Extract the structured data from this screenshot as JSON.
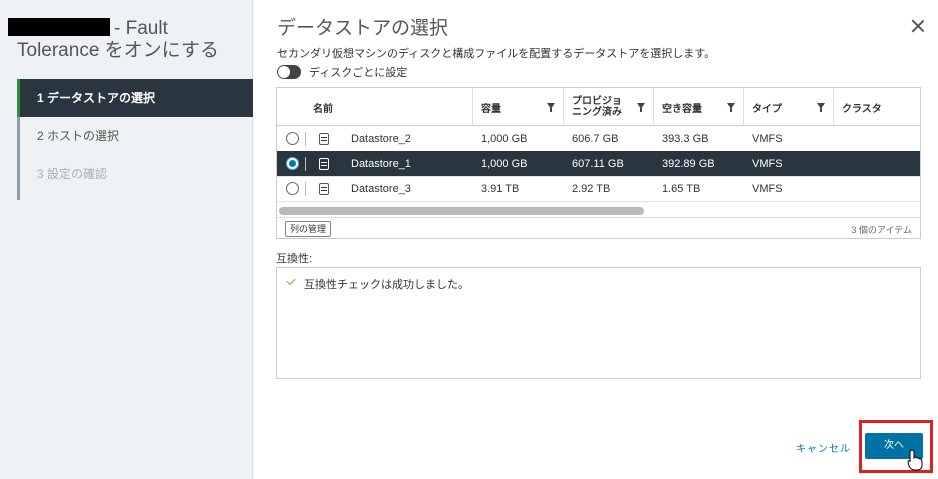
{
  "wizard": {
    "title_suffix": "- Fault",
    "title_line2": "Tolerance をオンにする",
    "steps": [
      {
        "label": "1 データストアの選択"
      },
      {
        "label": "2 ホストの選択"
      },
      {
        "label": "3 設定の確認"
      }
    ]
  },
  "page": {
    "heading": "データストアの選択",
    "description": "セカンダリ仮想マシンのディスクと構成ファイルを配置するデータストアを選択します。",
    "toggle_label": "ディスクごとに設定"
  },
  "grid": {
    "columns": [
      "名前",
      "容量",
      "プロビジョ\nニング済み",
      "空き容量",
      "タイプ",
      "クラスタ"
    ],
    "rows": [
      {
        "name": "Datastore_2",
        "capacity": "1,000 GB",
        "provisioned": "606.7 GB",
        "free": "393.3 GB",
        "type": "VMFS",
        "selected": false
      },
      {
        "name": "Datastore_1",
        "capacity": "1,000 GB",
        "provisioned": "607.11 GB",
        "free": "392.89 GB",
        "type": "VMFS",
        "selected": true
      },
      {
        "name": "Datastore_3",
        "capacity": "3.91 TB",
        "provisioned": "2.92 TB",
        "free": "1.65 TB",
        "type": "VMFS",
        "selected": false
      }
    ],
    "manage_columns_label": "列の管理",
    "item_count": "3 個のアイテム"
  },
  "compatibility": {
    "label": "互換性:",
    "message": "互換性チェックは成功しました。"
  },
  "buttons": {
    "cancel": "キャンセル",
    "next": "次へ"
  },
  "colors": {
    "accent": "#0072a3",
    "selected_row": "#29363f",
    "highlight": "#e0201c",
    "success": "#7aaf3a"
  }
}
